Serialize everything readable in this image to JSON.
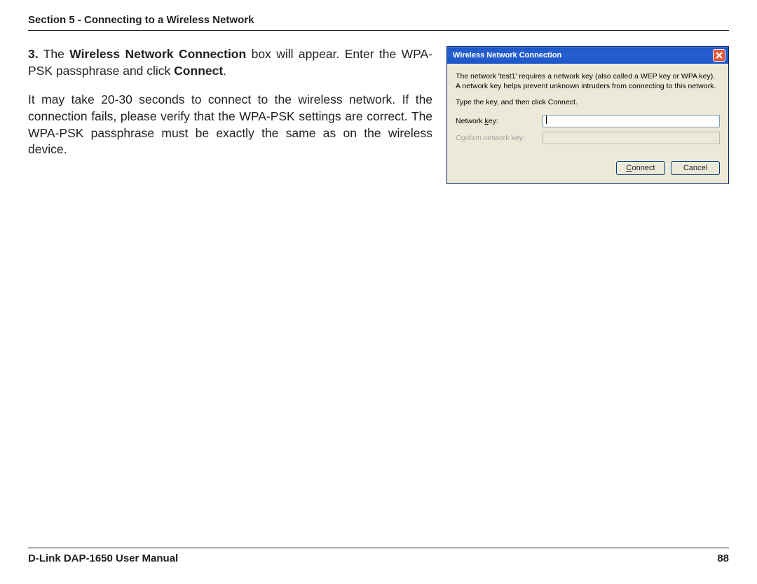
{
  "header": {
    "section_title": "Section 5 - Connecting to a Wireless Network"
  },
  "body": {
    "step_number": "3.",
    "step_text_1": "The ",
    "step_bold_1": "Wireless Network Connection",
    "step_text_2": " box will appear. Enter the WPA-PSK passphrase and click ",
    "step_bold_2": "Connect",
    "step_text_3": ".",
    "note": "It may take 20-30 seconds to connect to the wireless network. If the connection fails, please verify that the WPA-PSK settings are correct. The WPA-PSK passphrase must be exactly the same as on the wireless device."
  },
  "dialog": {
    "title": "Wireless Network Connection",
    "close_icon_name": "close-icon",
    "intro": "The network 'test1' requires a network key (also called a WEP key or WPA key). A network key helps prevent unknown intruders from connecting to this network.",
    "instruction": "Type the key, and then click Connect.",
    "network_key_label_pre": "Network ",
    "network_key_label_ul": "k",
    "network_key_label_post": "ey:",
    "confirm_label_pre": "C",
    "confirm_label_ul": "o",
    "confirm_label_post": "nfirm network key:",
    "network_key_value": "",
    "confirm_value": "",
    "connect_pre": "",
    "connect_ul": "C",
    "connect_post": "onnect",
    "cancel": "Cancel"
  },
  "footer": {
    "manual": "D-Link DAP-1650 User Manual",
    "page": "88"
  }
}
